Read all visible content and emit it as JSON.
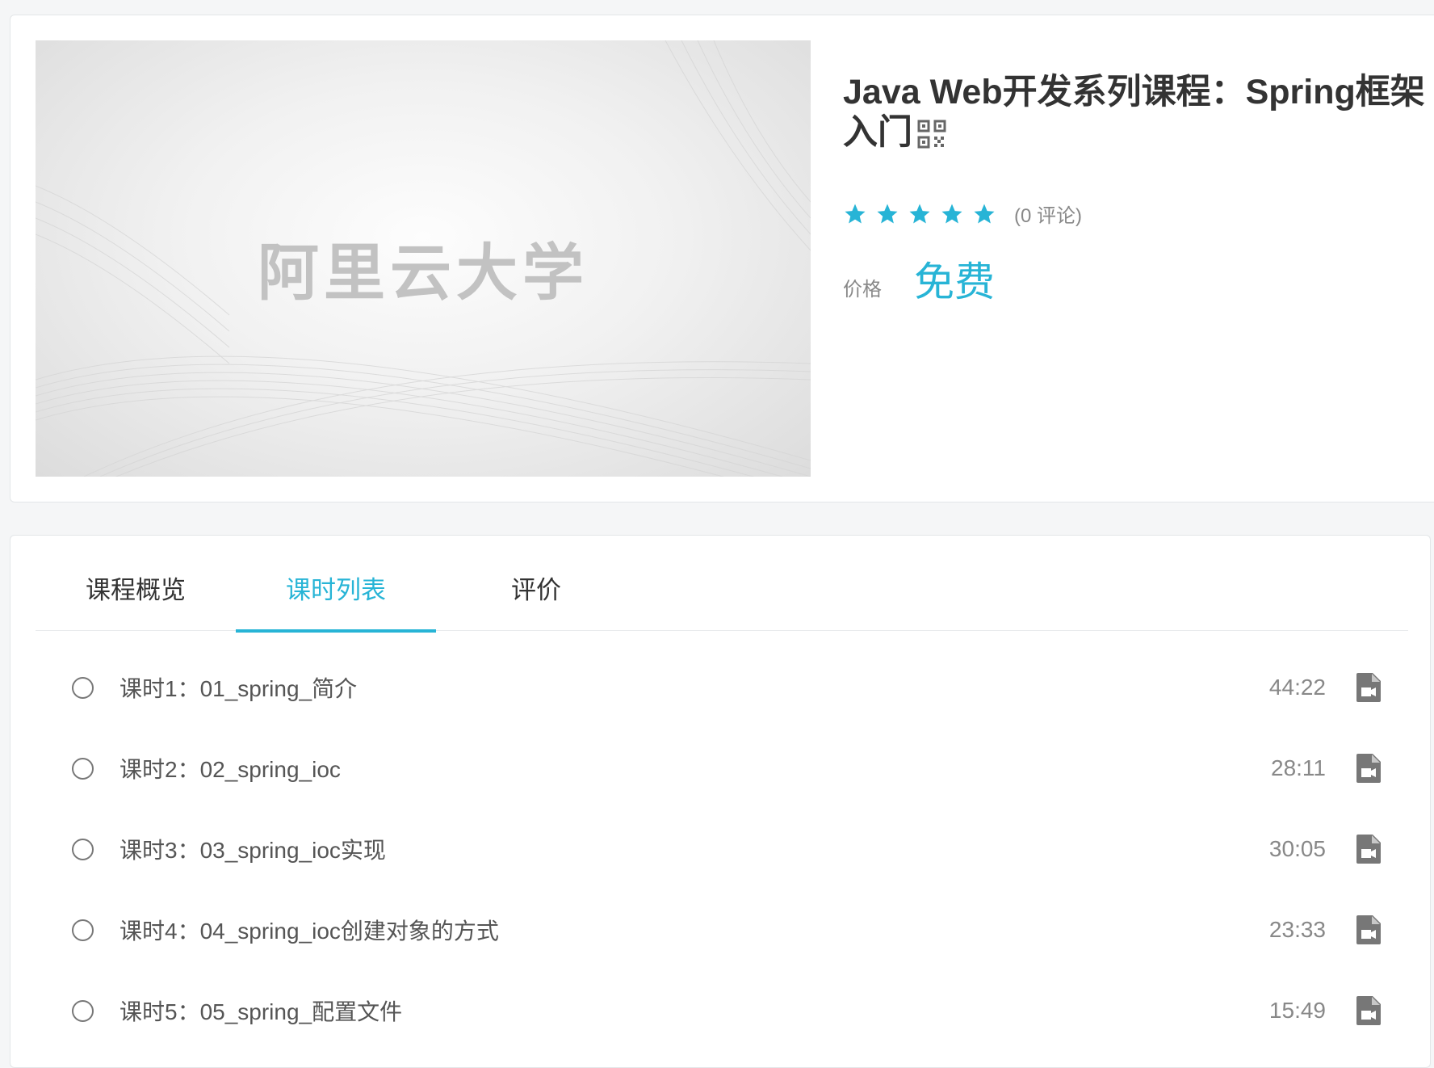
{
  "course": {
    "cover_text": "阿里云大学",
    "title": "Java Web开发系列课程：Spring框架入门",
    "rating_stars": 5,
    "review_count": "(0 评论)",
    "price_label": "价格",
    "price_value": "免费",
    "icons": {
      "qr": "qr-code-icon",
      "star": "star-icon"
    }
  },
  "colors": {
    "accent": "#27b4d6",
    "text": "#333333",
    "muted": "#888888"
  },
  "tabs": [
    {
      "label": "课程概览",
      "active": false
    },
    {
      "label": "课时列表",
      "active": true
    },
    {
      "label": "评价",
      "active": false
    }
  ],
  "lessons": [
    {
      "title": "课时1：01_spring_简介",
      "duration": "44:22",
      "icon": "video-file-icon"
    },
    {
      "title": "课时2：02_spring_ioc",
      "duration": "28:11",
      "icon": "video-file-icon"
    },
    {
      "title": "课时3：03_spring_ioc实现",
      "duration": "30:05",
      "icon": "video-file-icon"
    },
    {
      "title": "课时4：04_spring_ioc创建对象的方式",
      "duration": "23:33",
      "icon": "video-file-icon"
    },
    {
      "title": "课时5：05_spring_配置文件",
      "duration": "15:49",
      "icon": "video-file-icon"
    }
  ]
}
